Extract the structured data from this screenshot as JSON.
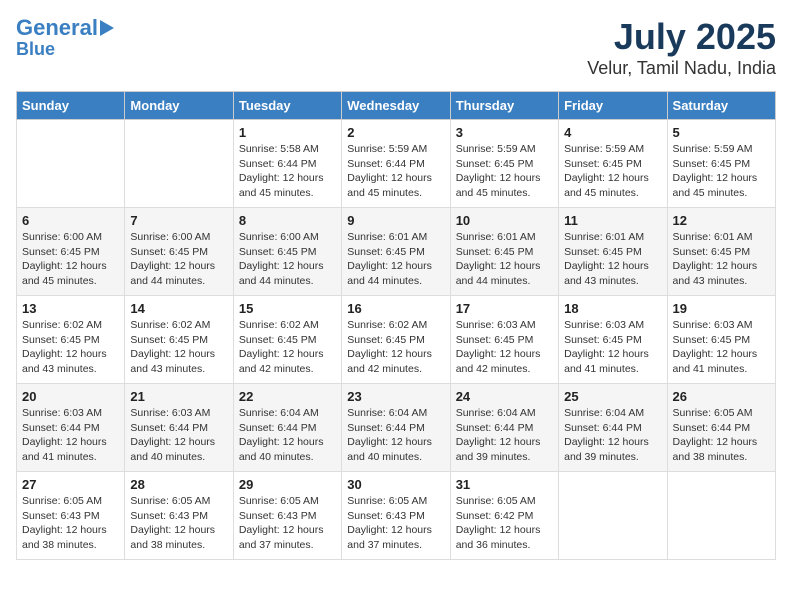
{
  "header": {
    "logo_line1": "General",
    "logo_line2": "Blue",
    "title": "July 2025",
    "subtitle": "Velur, Tamil Nadu, India"
  },
  "weekdays": [
    "Sunday",
    "Monday",
    "Tuesday",
    "Wednesday",
    "Thursday",
    "Friday",
    "Saturday"
  ],
  "weeks": [
    [
      {
        "day": "",
        "info": ""
      },
      {
        "day": "",
        "info": ""
      },
      {
        "day": "1",
        "info": "Sunrise: 5:58 AM\nSunset: 6:44 PM\nDaylight: 12 hours and 45 minutes."
      },
      {
        "day": "2",
        "info": "Sunrise: 5:59 AM\nSunset: 6:44 PM\nDaylight: 12 hours and 45 minutes."
      },
      {
        "day": "3",
        "info": "Sunrise: 5:59 AM\nSunset: 6:45 PM\nDaylight: 12 hours and 45 minutes."
      },
      {
        "day": "4",
        "info": "Sunrise: 5:59 AM\nSunset: 6:45 PM\nDaylight: 12 hours and 45 minutes."
      },
      {
        "day": "5",
        "info": "Sunrise: 5:59 AM\nSunset: 6:45 PM\nDaylight: 12 hours and 45 minutes."
      }
    ],
    [
      {
        "day": "6",
        "info": "Sunrise: 6:00 AM\nSunset: 6:45 PM\nDaylight: 12 hours and 45 minutes."
      },
      {
        "day": "7",
        "info": "Sunrise: 6:00 AM\nSunset: 6:45 PM\nDaylight: 12 hours and 44 minutes."
      },
      {
        "day": "8",
        "info": "Sunrise: 6:00 AM\nSunset: 6:45 PM\nDaylight: 12 hours and 44 minutes."
      },
      {
        "day": "9",
        "info": "Sunrise: 6:01 AM\nSunset: 6:45 PM\nDaylight: 12 hours and 44 minutes."
      },
      {
        "day": "10",
        "info": "Sunrise: 6:01 AM\nSunset: 6:45 PM\nDaylight: 12 hours and 44 minutes."
      },
      {
        "day": "11",
        "info": "Sunrise: 6:01 AM\nSunset: 6:45 PM\nDaylight: 12 hours and 43 minutes."
      },
      {
        "day": "12",
        "info": "Sunrise: 6:01 AM\nSunset: 6:45 PM\nDaylight: 12 hours and 43 minutes."
      }
    ],
    [
      {
        "day": "13",
        "info": "Sunrise: 6:02 AM\nSunset: 6:45 PM\nDaylight: 12 hours and 43 minutes."
      },
      {
        "day": "14",
        "info": "Sunrise: 6:02 AM\nSunset: 6:45 PM\nDaylight: 12 hours and 43 minutes."
      },
      {
        "day": "15",
        "info": "Sunrise: 6:02 AM\nSunset: 6:45 PM\nDaylight: 12 hours and 42 minutes."
      },
      {
        "day": "16",
        "info": "Sunrise: 6:02 AM\nSunset: 6:45 PM\nDaylight: 12 hours and 42 minutes."
      },
      {
        "day": "17",
        "info": "Sunrise: 6:03 AM\nSunset: 6:45 PM\nDaylight: 12 hours and 42 minutes."
      },
      {
        "day": "18",
        "info": "Sunrise: 6:03 AM\nSunset: 6:45 PM\nDaylight: 12 hours and 41 minutes."
      },
      {
        "day": "19",
        "info": "Sunrise: 6:03 AM\nSunset: 6:45 PM\nDaylight: 12 hours and 41 minutes."
      }
    ],
    [
      {
        "day": "20",
        "info": "Sunrise: 6:03 AM\nSunset: 6:44 PM\nDaylight: 12 hours and 41 minutes."
      },
      {
        "day": "21",
        "info": "Sunrise: 6:03 AM\nSunset: 6:44 PM\nDaylight: 12 hours and 40 minutes."
      },
      {
        "day": "22",
        "info": "Sunrise: 6:04 AM\nSunset: 6:44 PM\nDaylight: 12 hours and 40 minutes."
      },
      {
        "day": "23",
        "info": "Sunrise: 6:04 AM\nSunset: 6:44 PM\nDaylight: 12 hours and 40 minutes."
      },
      {
        "day": "24",
        "info": "Sunrise: 6:04 AM\nSunset: 6:44 PM\nDaylight: 12 hours and 39 minutes."
      },
      {
        "day": "25",
        "info": "Sunrise: 6:04 AM\nSunset: 6:44 PM\nDaylight: 12 hours and 39 minutes."
      },
      {
        "day": "26",
        "info": "Sunrise: 6:05 AM\nSunset: 6:44 PM\nDaylight: 12 hours and 38 minutes."
      }
    ],
    [
      {
        "day": "27",
        "info": "Sunrise: 6:05 AM\nSunset: 6:43 PM\nDaylight: 12 hours and 38 minutes."
      },
      {
        "day": "28",
        "info": "Sunrise: 6:05 AM\nSunset: 6:43 PM\nDaylight: 12 hours and 38 minutes."
      },
      {
        "day": "29",
        "info": "Sunrise: 6:05 AM\nSunset: 6:43 PM\nDaylight: 12 hours and 37 minutes."
      },
      {
        "day": "30",
        "info": "Sunrise: 6:05 AM\nSunset: 6:43 PM\nDaylight: 12 hours and 37 minutes."
      },
      {
        "day": "31",
        "info": "Sunrise: 6:05 AM\nSunset: 6:42 PM\nDaylight: 12 hours and 36 minutes."
      },
      {
        "day": "",
        "info": ""
      },
      {
        "day": "",
        "info": ""
      }
    ]
  ]
}
